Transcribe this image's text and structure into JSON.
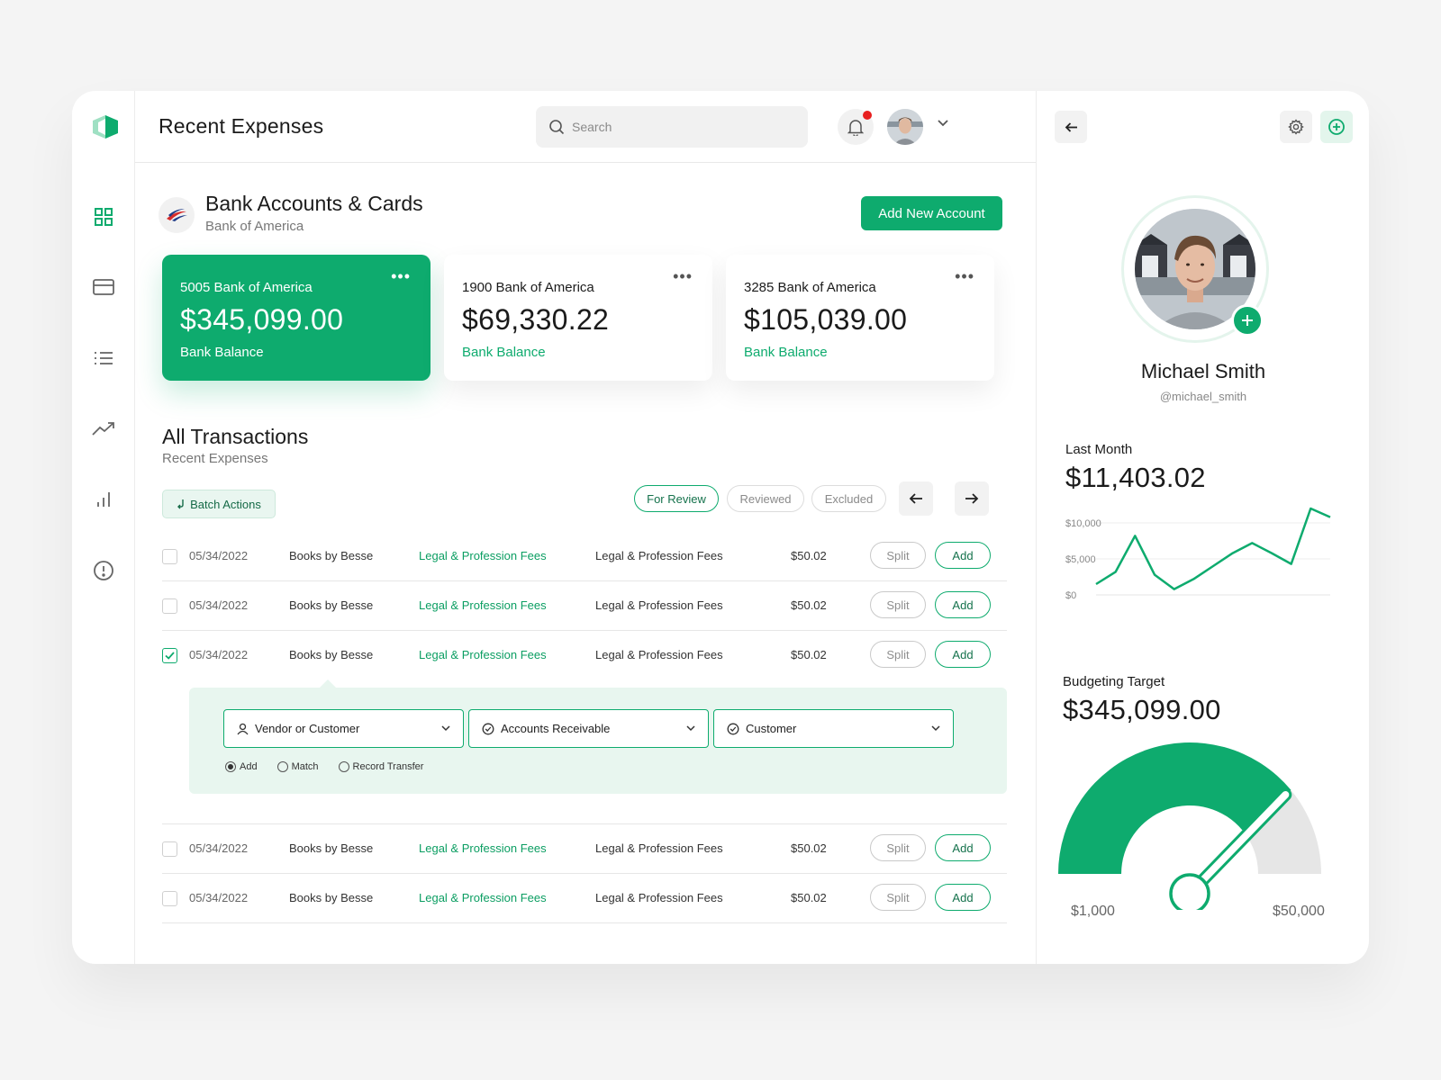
{
  "header": {
    "title": "Recent Expenses",
    "search_placeholder": "Search"
  },
  "bank_section": {
    "title": "Bank Accounts & Cards",
    "subtitle": "Bank of America",
    "add_button": "Add New Account"
  },
  "cards": [
    {
      "name": "5005 Bank of America",
      "amount": "$345,099.00",
      "label": "Bank Balance",
      "active": true
    },
    {
      "name": "1900 Bank of America",
      "amount": "$69,330.22",
      "label": "Bank Balance",
      "active": false
    },
    {
      "name": "3285 Bank of America",
      "amount": "$105,039.00",
      "label": "Bank Balance",
      "active": false
    }
  ],
  "card_menu_glyph": "•••",
  "transactions": {
    "title": "All Transactions",
    "subtitle": "Recent Expenses",
    "batch_label": "Batch Actions",
    "filters": [
      "For Review",
      "Reviewed",
      "Excluded"
    ],
    "active_filter": "For Review",
    "split_label": "Split",
    "add_label": "Add",
    "rows": [
      {
        "date": "05/34/2022",
        "vendor": "Books by Besse",
        "category": "Legal & Profession Fees",
        "category2": "Legal & Profession Fees",
        "amount": "$50.02",
        "checked": false
      },
      {
        "date": "05/34/2022",
        "vendor": "Books by Besse",
        "category": "Legal & Profession Fees",
        "category2": "Legal & Profession Fees",
        "amount": "$50.02",
        "checked": false
      },
      {
        "date": "05/34/2022",
        "vendor": "Books by Besse",
        "category": "Legal & Profession Fees",
        "category2": "Legal & Profession Fees",
        "amount": "$50.02",
        "checked": true
      },
      {
        "date": "05/34/2022",
        "vendor": "Books by Besse",
        "category": "Legal & Profession Fees",
        "category2": "Legal & Profession Fees",
        "amount": "$50.02",
        "checked": false
      },
      {
        "date": "05/34/2022",
        "vendor": "Books by Besse",
        "category": "Legal & Profession Fees",
        "category2": "Legal & Profession Fees",
        "amount": "$50.02",
        "checked": false
      }
    ]
  },
  "expand_panel": {
    "select_vendor": "Vendor or Customer",
    "select_account": "Accounts Receivable",
    "select_customer": "Customer",
    "radio_options": [
      "Add",
      "Match",
      "Record Transfer"
    ],
    "selected_radio": "Add"
  },
  "profile": {
    "name": "Michael Smith",
    "handle": "@michael_smith"
  },
  "last_month": {
    "label": "Last Month",
    "amount": "$11,403.02",
    "y_ticks": [
      "$10,000",
      "$5,000",
      "$0"
    ],
    "values": [
      1500,
      3200,
      8200,
      2800,
      800,
      2200,
      4000,
      5800,
      7200,
      5800,
      4300,
      12000,
      10800
    ]
  },
  "budget": {
    "label": "Budgeting Target",
    "amount": "$345,099.00",
    "min_label": "$1,000",
    "max_label": "$50,000",
    "fill_fraction": 0.78
  },
  "colors": {
    "accent": "#0eab6e",
    "accent_light": "#e8f6ef",
    "alert": "#e81f1f"
  },
  "icons": [
    "logo-icon",
    "dashboard-icon",
    "card-icon",
    "list-icon",
    "trend-icon",
    "bar-chart-icon",
    "alert-icon",
    "search-icon",
    "bell-icon",
    "chevron-down-icon",
    "back-arrow-icon",
    "forward-arrow-icon",
    "gear-icon",
    "plus-icon",
    "user-icon",
    "check-circle-icon"
  ]
}
